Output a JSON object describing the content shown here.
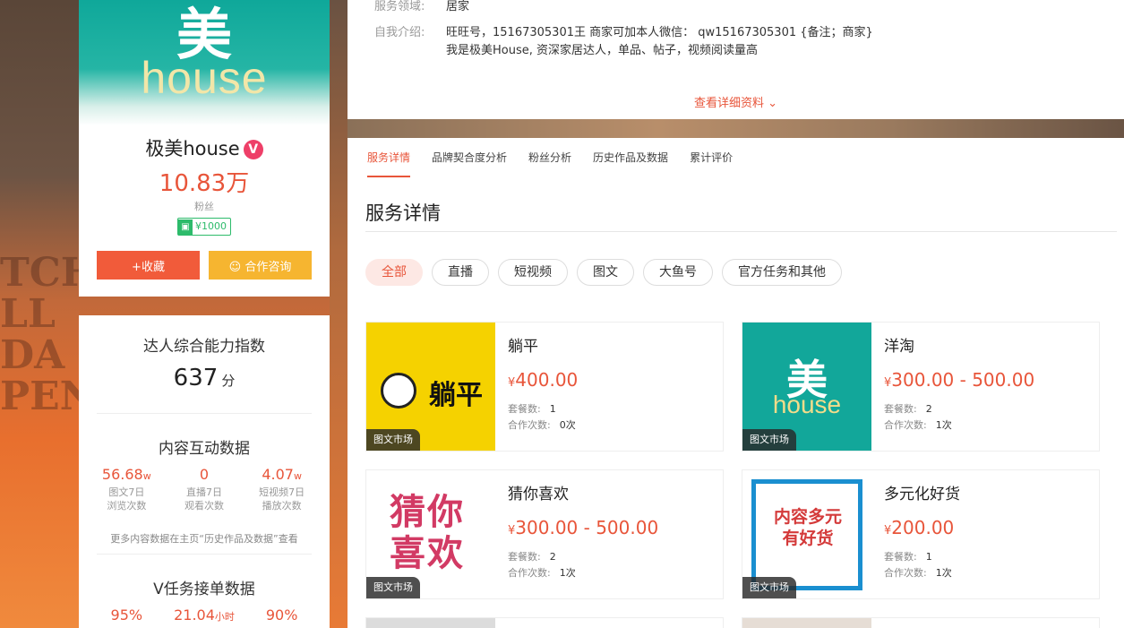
{
  "profile": {
    "avatar_top": "美",
    "avatar_bottom": "house",
    "name": "极美house",
    "verified_mark": "V",
    "fans": "10.83万",
    "fans_label": "粉丝",
    "price": "¥1000",
    "fav_button": "+收藏",
    "consult_button": "合作咨询"
  },
  "stats": {
    "ability_title": "达人综合能力指数",
    "ability_score": "637",
    "ability_unit": "分",
    "interaction_title": "内容互动数据",
    "interaction": [
      {
        "value": "56.68",
        "unit": "w",
        "label1": "图文7日",
        "label2": "浏览次数"
      },
      {
        "value": "0",
        "unit": "",
        "label1": "直播7日",
        "label2": "观看次数"
      },
      {
        "value": "4.07",
        "unit": "w",
        "label1": "短视频7日",
        "label2": "播放次数"
      }
    ],
    "note": "更多内容数据在主页“历史作品及数据”查看",
    "vtask_title": "V任务接单数据",
    "vtask": [
      {
        "value": "95%",
        "unit": ""
      },
      {
        "value": "21.04",
        "unit": "小时"
      },
      {
        "value": "90%",
        "unit": ""
      }
    ]
  },
  "intro": {
    "domain_label": "服务领域:",
    "domain_value": "居家",
    "self_label": "自我介绍:",
    "self_line1": "旺旺号，15167305301王 商家可加本人微信： qw15167305301 {备注；商家}",
    "self_line2": "我是极美House, 资深家居达人，单品、帖子，视频阅读量高",
    "more_link": "查看详细资料"
  },
  "tabs": [
    "服务详情",
    "品牌契合度分析",
    "粉丝分析",
    "历史作品及数据",
    "累计评价"
  ],
  "section_title": "服务详情",
  "filters": [
    "全部",
    "直播",
    "短视频",
    "图文",
    "大鱼号",
    "官方任务和其他"
  ],
  "services": [
    {
      "name": "躺平",
      "price": "400.00",
      "packages_label": "套餐数:",
      "packages": "1",
      "coop_label": "合作次数:",
      "coop": "0次",
      "tag": "图文市场",
      "thumb_text": "躺平"
    },
    {
      "name": "洋淘",
      "price": "300.00 - 500.00",
      "packages_label": "套餐数:",
      "packages": "2",
      "coop_label": "合作次数:",
      "coop": "1次",
      "tag": "图文市场",
      "thumb_text": "美"
    },
    {
      "name": "猜你喜欢",
      "price": "300.00 - 500.00",
      "packages_label": "套餐数:",
      "packages": "2",
      "coop_label": "合作次数:",
      "coop": "1次",
      "tag": "图文市场",
      "thumb_text": "猜你喜欢"
    },
    {
      "name": "多元化好货",
      "price": "200.00",
      "packages_label": "套餐数:",
      "packages": "1",
      "coop_label": "合作次数:",
      "coop": "1次",
      "tag": "图文市场",
      "thumb_text": "内容多元有好货"
    }
  ],
  "currency": "¥",
  "colors": {
    "accent": "#e8553a",
    "fav": "#f15b3a",
    "consult": "#f6b530",
    "price_badge": "#2dbb6b"
  }
}
